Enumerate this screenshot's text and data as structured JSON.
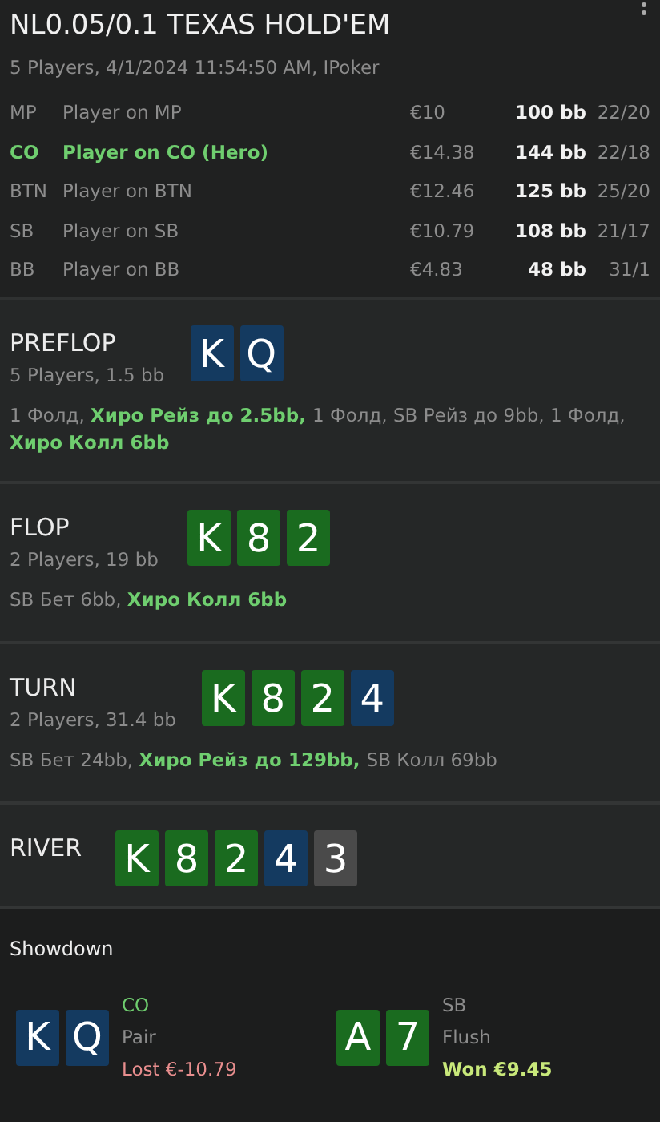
{
  "title": "NL0.05/0.1 TEXAS HOLD'EM",
  "subtitle": "5 Players, 4/1/2024 11:54:50 AM, IPoker",
  "players": [
    {
      "position": "MP",
      "name": "Player on MP",
      "hero": false,
      "money": "€10",
      "stack": "100 bb",
      "stats": "22/20"
    },
    {
      "position": "CO",
      "name": "Player on CO (Hero)",
      "hero": true,
      "money": "€14.38",
      "stack": "144 bb",
      "stats": "22/18"
    },
    {
      "position": "BTN",
      "name": "Player on BTN",
      "hero": false,
      "money": "€12.46",
      "stack": "125 bb",
      "stats": "25/20"
    },
    {
      "position": "SB",
      "name": "Player on SB",
      "hero": false,
      "money": "€10.79",
      "stack": "108 bb",
      "stats": "21/17"
    },
    {
      "position": "BB",
      "name": "Player on BB",
      "hero": false,
      "money": "€4.83",
      "stack": "48 bb",
      "stats": "31/1"
    }
  ],
  "streets": [
    {
      "name": "PREFLOP",
      "info": "5 Players, 1.5 bb",
      "cards": [
        {
          "rank": "K",
          "color": "#143a60"
        },
        {
          "rank": "Q",
          "color": "#143a60"
        }
      ],
      "actions": [
        {
          "text": "1 Фолд, ",
          "hero": false
        },
        {
          "text": "Хиро Рейз до 2.5bb, ",
          "hero": true
        },
        {
          "text": "1 Фолд, SB Рейз до 9bb, 1 Фолд, ",
          "hero": false
        },
        {
          "text": "Хиро Колл 6bb",
          "hero": true
        }
      ]
    },
    {
      "name": "FLOP",
      "info": "2 Players, 19 bb",
      "cards": [
        {
          "rank": "K",
          "color": "#1a6b1f"
        },
        {
          "rank": "8",
          "color": "#1a6b1f"
        },
        {
          "rank": "2",
          "color": "#1a6b1f"
        }
      ],
      "actions": [
        {
          "text": "SB Бет 6bb, ",
          "hero": false
        },
        {
          "text": "Хиро Колл 6bb",
          "hero": true
        }
      ]
    },
    {
      "name": "TURN",
      "info": "2 Players, 31.4 bb",
      "cards": [
        {
          "rank": "K",
          "color": "#1a6b1f"
        },
        {
          "rank": "8",
          "color": "#1a6b1f"
        },
        {
          "rank": "2",
          "color": "#1a6b1f"
        },
        {
          "rank": "4",
          "color": "#143a60"
        }
      ],
      "actions": [
        {
          "text": "SB Бет 24bb, ",
          "hero": false
        },
        {
          "text": "Хиро Рейз до 129bb, ",
          "hero": true
        },
        {
          "text": "SB Колл 69bb",
          "hero": false
        }
      ]
    },
    {
      "name": "RIVER",
      "cards": [
        {
          "rank": "K",
          "color": "#1a6b1f"
        },
        {
          "rank": "8",
          "color": "#1a6b1f"
        },
        {
          "rank": "2",
          "color": "#1a6b1f"
        },
        {
          "rank": "4",
          "color": "#143a60"
        },
        {
          "rank": "3",
          "color": "#4a4a4a"
        }
      ]
    }
  ],
  "showdown": {
    "title": "Showdown",
    "hands": [
      {
        "cards": [
          {
            "rank": "K",
            "color": "#143a60"
          },
          {
            "rank": "Q",
            "color": "#143a60"
          }
        ],
        "position": "CO",
        "hero": true,
        "combo": "Pair",
        "result": "Lost €-10.79",
        "kind": "lost"
      },
      {
        "cards": [
          {
            "rank": "A",
            "color": "#1a6b1f"
          },
          {
            "rank": "7",
            "color": "#1a6b1f"
          }
        ],
        "position": "SB",
        "hero": false,
        "combo": "Flush",
        "result": "Won €9.45",
        "kind": "won"
      }
    ]
  }
}
